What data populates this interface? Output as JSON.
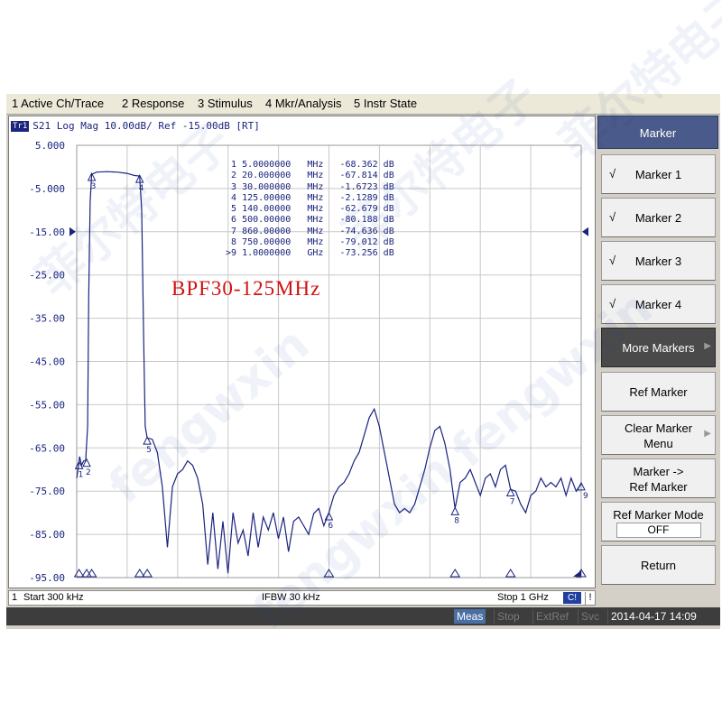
{
  "menu": [
    "1 Active Ch/Trace",
    "2 Response",
    "3 Stimulus",
    "4 Mkr/Analysis",
    "5 Instr State"
  ],
  "trace_header": {
    "badge": "Tr1",
    "text": "S21  Log Mag 10.00dB/ Ref -15.00dB [RT]"
  },
  "marker_table": [
    {
      "id": "1",
      "freq": "5.0000000",
      "unit": "MHz",
      "value": "-68.362",
      "vunit": "dB"
    },
    {
      "id": "2",
      "freq": "20.000000",
      "unit": "MHz",
      "value": "-67.814",
      "vunit": "dB"
    },
    {
      "id": "3",
      "freq": "30.000000",
      "unit": "MHz",
      "value": "-1.6723",
      "vunit": "dB"
    },
    {
      "id": "4",
      "freq": "125.00000",
      "unit": "MHz",
      "value": "-2.1289",
      "vunit": "dB"
    },
    {
      "id": "5",
      "freq": "140.00000",
      "unit": "MHz",
      "value": "-62.679",
      "vunit": "dB"
    },
    {
      "id": "6",
      "freq": "500.00000",
      "unit": "MHz",
      "value": "-80.188",
      "vunit": "dB"
    },
    {
      "id": "7",
      "freq": "860.00000",
      "unit": "MHz",
      "value": "-74.636",
      "vunit": "dB"
    },
    {
      "id": "8",
      "freq": "750.00000",
      "unit": "MHz",
      "value": "-79.012",
      "vunit": "dB"
    },
    {
      "id": ">9",
      "freq": "1.0000000",
      "unit": "GHz",
      "value": "-73.256",
      "vunit": "dB"
    }
  ],
  "annotation": "BPF30-125MHz",
  "bottom_bar": {
    "channel": "1",
    "start": "Start 300 kHz",
    "ifbw": "IFBW 30 kHz",
    "stop": "Stop 1 GHz",
    "c_badge": "C!",
    "exclaim": "!"
  },
  "status_bar": {
    "meas": "Meas",
    "stop": "Stop",
    "extref": "ExtRef",
    "svc": "Svc",
    "datetime": "2014-04-17 14:09"
  },
  "softkeys": {
    "title": "Marker",
    "items": [
      {
        "label": "Marker 1",
        "checked": true
      },
      {
        "label": "Marker 2",
        "checked": true
      },
      {
        "label": "Marker 3",
        "checked": true
      },
      {
        "label": "Marker 4",
        "checked": true
      },
      {
        "label": "More Markers",
        "dark": true,
        "arrow": true
      },
      {
        "label": "Ref Marker"
      },
      {
        "label": "Clear Marker",
        "label2": "Menu",
        "arrow": true
      },
      {
        "label": "Marker ->",
        "label2": "Ref Marker"
      },
      {
        "label": "Ref Marker Mode",
        "value": "OFF"
      },
      {
        "label": "Return"
      }
    ],
    "check_glyph": "√",
    "arrow_glyph": "▶"
  },
  "watermark": [
    "菲尔特电子",
    "fengwxin"
  ],
  "colors": {
    "trace": "#1a237e",
    "grid": "#c8c8c8",
    "annotation": "#d01010",
    "softkey_title": "#4a5a8a",
    "status_bar": "#3d3d3d"
  },
  "chart_data": {
    "type": "line",
    "y_ticks": [
      "5.000",
      "-5.000",
      "-15.00",
      "-25.00",
      "-35.00",
      "-45.00",
      "-55.00",
      "-65.00",
      "-75.00",
      "-85.00",
      "-95.00"
    ],
    "ylim": [
      -95,
      5
    ],
    "xlim": [
      0.3,
      1000
    ],
    "x_unit": "MHz",
    "ref_level": -15,
    "scale_per_div": 10,
    "grid": true,
    "series": [
      {
        "x": [
          0.3,
          3,
          6,
          10,
          14,
          18,
          22,
          24,
          27,
          30,
          40,
          60,
          80,
          100,
          115,
          125,
          129,
          133,
          136,
          140,
          150,
          160,
          170,
          180,
          190,
          200,
          210,
          220,
          230,
          240,
          250,
          260,
          270,
          280,
          290,
          300,
          310,
          320,
          330,
          340,
          350,
          360,
          370,
          380,
          390,
          400,
          410,
          420,
          430,
          440,
          450,
          460,
          470,
          480,
          490,
          500,
          510,
          520,
          530,
          540,
          550,
          560,
          570,
          580,
          590,
          600,
          610,
          620,
          630,
          640,
          650,
          660,
          670,
          680,
          690,
          700,
          710,
          720,
          730,
          740,
          750,
          760,
          770,
          780,
          790,
          800,
          810,
          820,
          830,
          840,
          850,
          860,
          870,
          880,
          890,
          900,
          910,
          920,
          930,
          940,
          950,
          960,
          970,
          980,
          990,
          1000
        ],
        "y": [
          -72,
          -70,
          -67,
          -69,
          -68,
          -68,
          -60,
          -30,
          -8,
          -1.7,
          -1.2,
          -1.1,
          -1.2,
          -1.5,
          -2.0,
          -2.1,
          -10,
          -40,
          -60,
          -62.7,
          -63,
          -66,
          -74,
          -88,
          -74,
          -71,
          -70,
          -68,
          -69,
          -72,
          -78,
          -92,
          -80,
          -93,
          -82,
          -94,
          -80,
          -87,
          -84,
          -90,
          -80,
          -88,
          -81,
          -84,
          -80,
          -86,
          -81,
          -89,
          -82,
          -81,
          -83,
          -85,
          -80.2,
          -79,
          -83,
          -80,
          -76,
          -74,
          -73,
          -71,
          -68,
          -66,
          -62,
          -58,
          -56,
          -60,
          -66,
          -72,
          -78,
          -80,
          -79,
          -80,
          -78,
          -74,
          -70,
          -65,
          -61,
          -60,
          -64,
          -70,
          -79,
          -73,
          -72,
          -70,
          -73,
          -76,
          -72,
          -71,
          -74,
          -70,
          -69,
          -74.6,
          -75,
          -78,
          -80,
          -76,
          -75,
          -72,
          -74,
          -73,
          -74,
          -72,
          -76,
          -72,
          -75,
          -73.3
        ]
      }
    ],
    "markers": [
      {
        "id": "1",
        "x": 5,
        "y": -68.362
      },
      {
        "id": "2",
        "x": 20,
        "y": -67.814
      },
      {
        "id": "3",
        "x": 30,
        "y": -1.6723
      },
      {
        "id": "4",
        "x": 125,
        "y": -2.1289
      },
      {
        "id": "5",
        "x": 140,
        "y": -62.679
      },
      {
        "id": "6",
        "x": 500,
        "y": -80.188
      },
      {
        "id": "7",
        "x": 860,
        "y": -74.636
      },
      {
        "id": "8",
        "x": 750,
        "y": -79.012
      },
      {
        "id": "9",
        "x": 1000,
        "y": -73.256
      }
    ]
  }
}
